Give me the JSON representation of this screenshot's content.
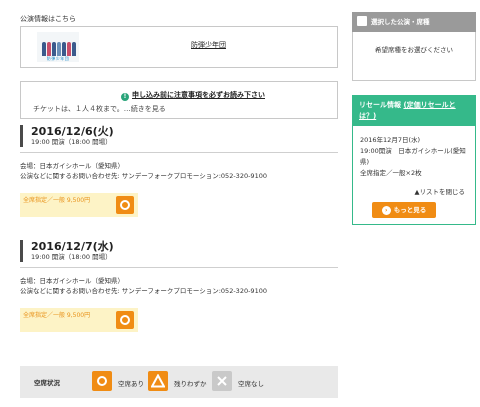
{
  "info": {
    "label": "公演情報はこちら",
    "link_text": "防弾少年団",
    "thumb_caption": "防弾少年団"
  },
  "notice": {
    "icon": "!",
    "heading": "申し込み前に注意事項を必ずお読み下さい",
    "body": "チケットは、１人４枚まで。…続きを見る"
  },
  "events": [
    {
      "date": "2016/12/6(火)",
      "time": "19:00 開演（18:00 開場）",
      "venue": "会場：日本ガイシホール（愛知県）",
      "contact": "公演などに関するお問い合わせ先: サンデーフォークプロモーション:052-320-9100",
      "ticket": "全席指定／一般 9,500円"
    },
    {
      "date": "2016/12/7(水)",
      "time": "19:00 開演（18:00 開場）",
      "venue": "会場：日本ガイシホール（愛知県）",
      "contact": "公演などに関するお問い合わせ先: サンデーフォークプロモーション:052-320-9100",
      "ticket": "全席指定／一般 9,500円"
    }
  ],
  "legend": {
    "title": "空席状況",
    "available": "空席あり",
    "few": "残りわずか",
    "none": "空席なし"
  },
  "sidebar": {
    "selected_title": "選択した公演・席種",
    "selected_body": "希望席種をお選びください",
    "resale_title": "リセール情報",
    "resale_link": "(定価リセールとは？)",
    "resale_item_1": "2016年12月7日(水)",
    "resale_item_2": "19:00開演　日本ガイシホール(愛知県)",
    "resale_item_3": "全席指定／一般×2枚",
    "close_list": "▲リストを閉じる",
    "more_button": "もっと見る",
    "more_arrow": "›"
  },
  "colors": {
    "accent_orange": "#f08c14",
    "resale_green": "#35b98a",
    "ticket_bg": "#fdf3c6",
    "legend_bg": "#e9e9e9"
  }
}
